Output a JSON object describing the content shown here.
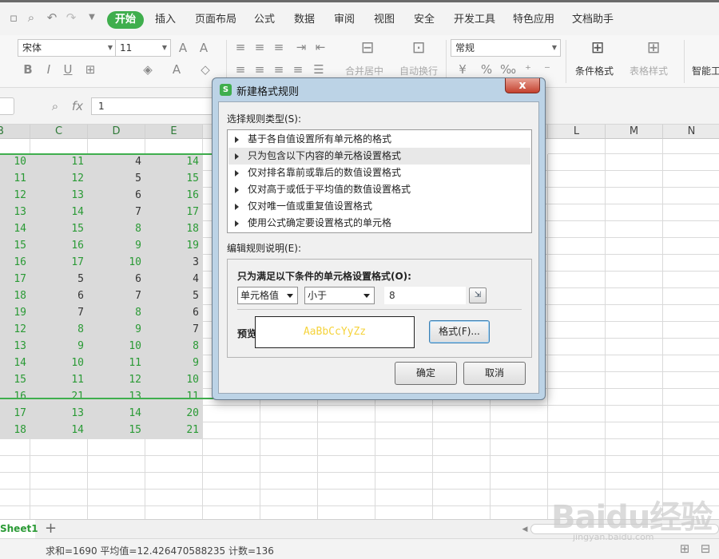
{
  "menu": {
    "items": [
      "开始",
      "插入",
      "页面布局",
      "公式",
      "数据",
      "审阅",
      "视图",
      "安全",
      "开发工具",
      "特色应用",
      "文档助手"
    ],
    "active": "开始"
  },
  "ribbon": {
    "font_name": "宋体",
    "font_size": "11",
    "merge_center": "合并居中",
    "wrap_text": "自动换行",
    "number_format": "常规",
    "conditional_format": "条件格式",
    "table_style": "表格样式",
    "smart": "智能工"
  },
  "formula_bar": {
    "fx_label": "fx",
    "value": "1"
  },
  "columns": {
    "left": [
      "B",
      "C",
      "D",
      "E"
    ],
    "right": [
      "L",
      "M",
      "N"
    ]
  },
  "rows": [
    [
      "10",
      "11",
      "4",
      "14"
    ],
    [
      "11",
      "12",
      "5",
      "15"
    ],
    [
      "12",
      "13",
      "6",
      "16"
    ],
    [
      "13",
      "14",
      "7",
      "17"
    ],
    [
      "14",
      "15",
      "8",
      "18"
    ],
    [
      "15",
      "16",
      "9",
      "19"
    ],
    [
      "16",
      "17",
      "10",
      "3"
    ],
    [
      "17",
      "5",
      "6",
      "4"
    ],
    [
      "18",
      "6",
      "7",
      "5"
    ],
    [
      "19",
      "7",
      "8",
      "6"
    ],
    [
      "12",
      "8",
      "9",
      "7"
    ],
    [
      "13",
      "9",
      "10",
      "8"
    ],
    [
      "14",
      "10",
      "11",
      "9"
    ],
    [
      "15",
      "11",
      "12",
      "10"
    ],
    [
      "16",
      "21",
      "13",
      "11"
    ],
    [
      "17",
      "13",
      "14",
      "20"
    ],
    [
      "18",
      "14",
      "15",
      "21"
    ]
  ],
  "sheet": {
    "tab": "Sheet1",
    "add": "+"
  },
  "status": {
    "text": "求和=1690  平均值=12.426470588235  计数=136"
  },
  "dialog": {
    "title": "新建格式规则",
    "close": "x",
    "rule_type_label": "选择规则类型(S):",
    "rule_types": [
      "基于各自值设置所有单元格的格式",
      "只为包含以下内容的单元格设置格式",
      "仅对排名靠前或靠后的数值设置格式",
      "仅对高于或低于平均值的数值设置格式",
      "仅对唯一值或重复值设置格式",
      "使用公式确定要设置格式的单元格"
    ],
    "selected_rule_index": 1,
    "edit_label": "编辑规则说明(E):",
    "condition_heading": "只为满足以下条件的单元格设置格式(O):",
    "condition_field": "单元格值",
    "operator": "小于",
    "value": "8",
    "preview_label": "预览:",
    "preview_text": "AaBbCcYyZz",
    "preview_color": "#f5d33c",
    "format_button": "格式(F)...",
    "ok_button": "确定",
    "cancel_button": "取消"
  },
  "watermark": {
    "brand": "Baidu经验",
    "url": "jingyan.baidu.com"
  }
}
